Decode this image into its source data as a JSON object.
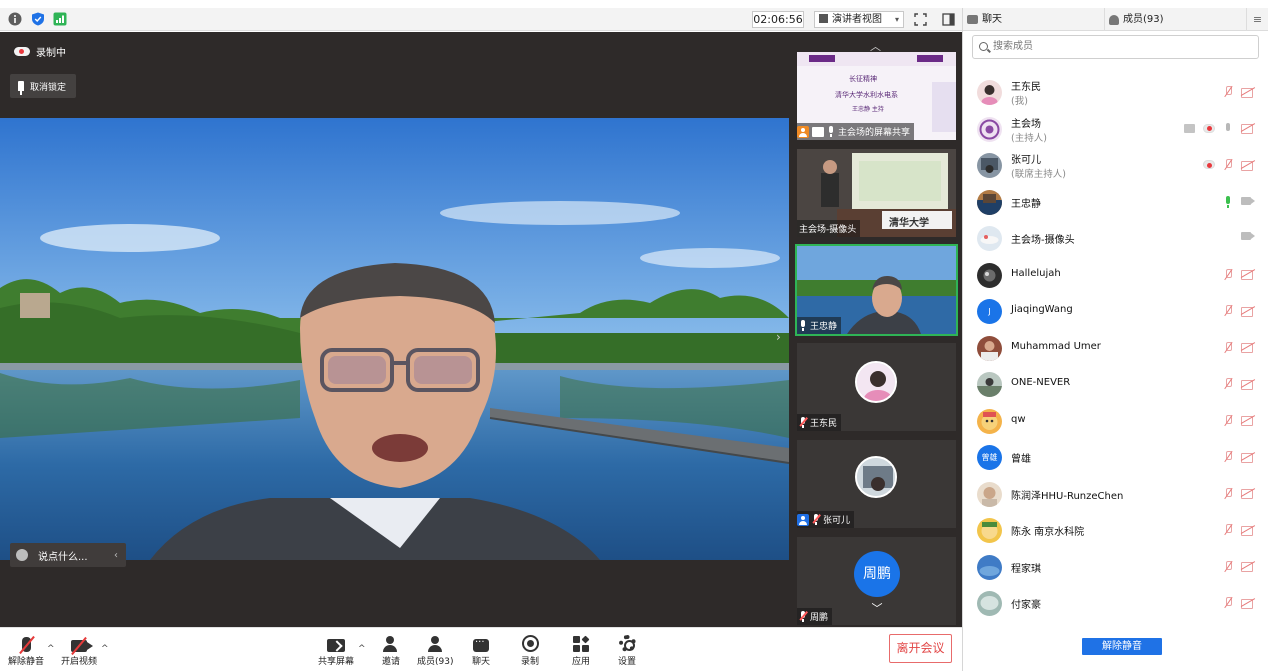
{
  "topbar": {
    "timer": "02:06:56",
    "view_mode": "演讲者视图"
  },
  "stage": {
    "recording_label": "录制中",
    "unpin_label": "取消锁定",
    "chat_placeholder": "说点什么..."
  },
  "thumbnails": [
    {
      "label": "主会场的屏幕共享"
    },
    {
      "label": "主会场-摄像头"
    },
    {
      "label": "王忠静",
      "active": true
    },
    {
      "label": "王东民"
    },
    {
      "label": "张可儿"
    },
    {
      "label": "周鹏",
      "avatar_text": "周鹏"
    }
  ],
  "slide_text": {
    "line1": "长征精神",
    "line2": "清华大学水利水电系",
    "line3": "王忠静 主持",
    "camera_banner": "清华大学"
  },
  "right_panel": {
    "tab_chat": "聊天",
    "tab_members": "成员(93)",
    "search_placeholder": "搜索成员",
    "unmute_all": "解除静音",
    "members": [
      {
        "name": "王东民",
        "role": "(我)",
        "icons": [
          "mic-off",
          "cam-off"
        ]
      },
      {
        "name": "主会场",
        "role": "(主持人)",
        "icons": [
          "share",
          "rec",
          "mic-grey",
          "cam-off"
        ]
      },
      {
        "name": "张可儿",
        "role": "(联席主持人)",
        "icons": [
          "rec",
          "mic-off",
          "cam-off"
        ]
      },
      {
        "name": "王忠静",
        "role": "",
        "icons": [
          "mic-green",
          "cam-grey"
        ]
      },
      {
        "name": "主会场-摄像头",
        "role": "",
        "icons": [
          "cam-grey"
        ]
      },
      {
        "name": "Hallelujah",
        "role": "",
        "icons": [
          "mic-off",
          "cam-off"
        ]
      },
      {
        "name": "JiaqingWang",
        "role": "",
        "avatar_text": "J",
        "icons": [
          "mic-off",
          "cam-off"
        ]
      },
      {
        "name": "Muhammad Umer",
        "role": "",
        "icons": [
          "mic-off",
          "cam-off"
        ]
      },
      {
        "name": "ONE-NEVER",
        "role": "",
        "icons": [
          "mic-off",
          "cam-off"
        ]
      },
      {
        "name": "qw",
        "role": "",
        "icons": [
          "mic-off",
          "cam-off"
        ]
      },
      {
        "name": "曾雄",
        "role": "",
        "avatar_text": "曾雄",
        "icons": [
          "mic-off",
          "cam-off"
        ]
      },
      {
        "name": "陈润泽HHU-RunzeChen",
        "role": "",
        "icons": [
          "mic-off",
          "cam-off"
        ]
      },
      {
        "name": "陈永  南京水科院",
        "role": "",
        "icons": [
          "mic-off",
          "cam-off"
        ]
      },
      {
        "name": "程家琪",
        "role": "",
        "icons": [
          "mic-off",
          "cam-off"
        ]
      },
      {
        "name": "付家豪",
        "role": "",
        "icons": [
          "mic-off",
          "cam-off"
        ]
      }
    ]
  },
  "toolbar": {
    "unmute": "解除静音",
    "start_video": "开启视频",
    "share_screen": "共享屏幕",
    "invite": "邀请",
    "members": "成员(93)",
    "chat": "聊天",
    "record": "录制",
    "apps": "应用",
    "settings": "设置",
    "leave": "离开会议"
  },
  "colors": {
    "stage_bg": "#2e2a29",
    "accent_blue": "#1f72e6",
    "leave_red": "#e24646",
    "active_green": "#2fb456",
    "muted_red": "#e77b7b"
  }
}
